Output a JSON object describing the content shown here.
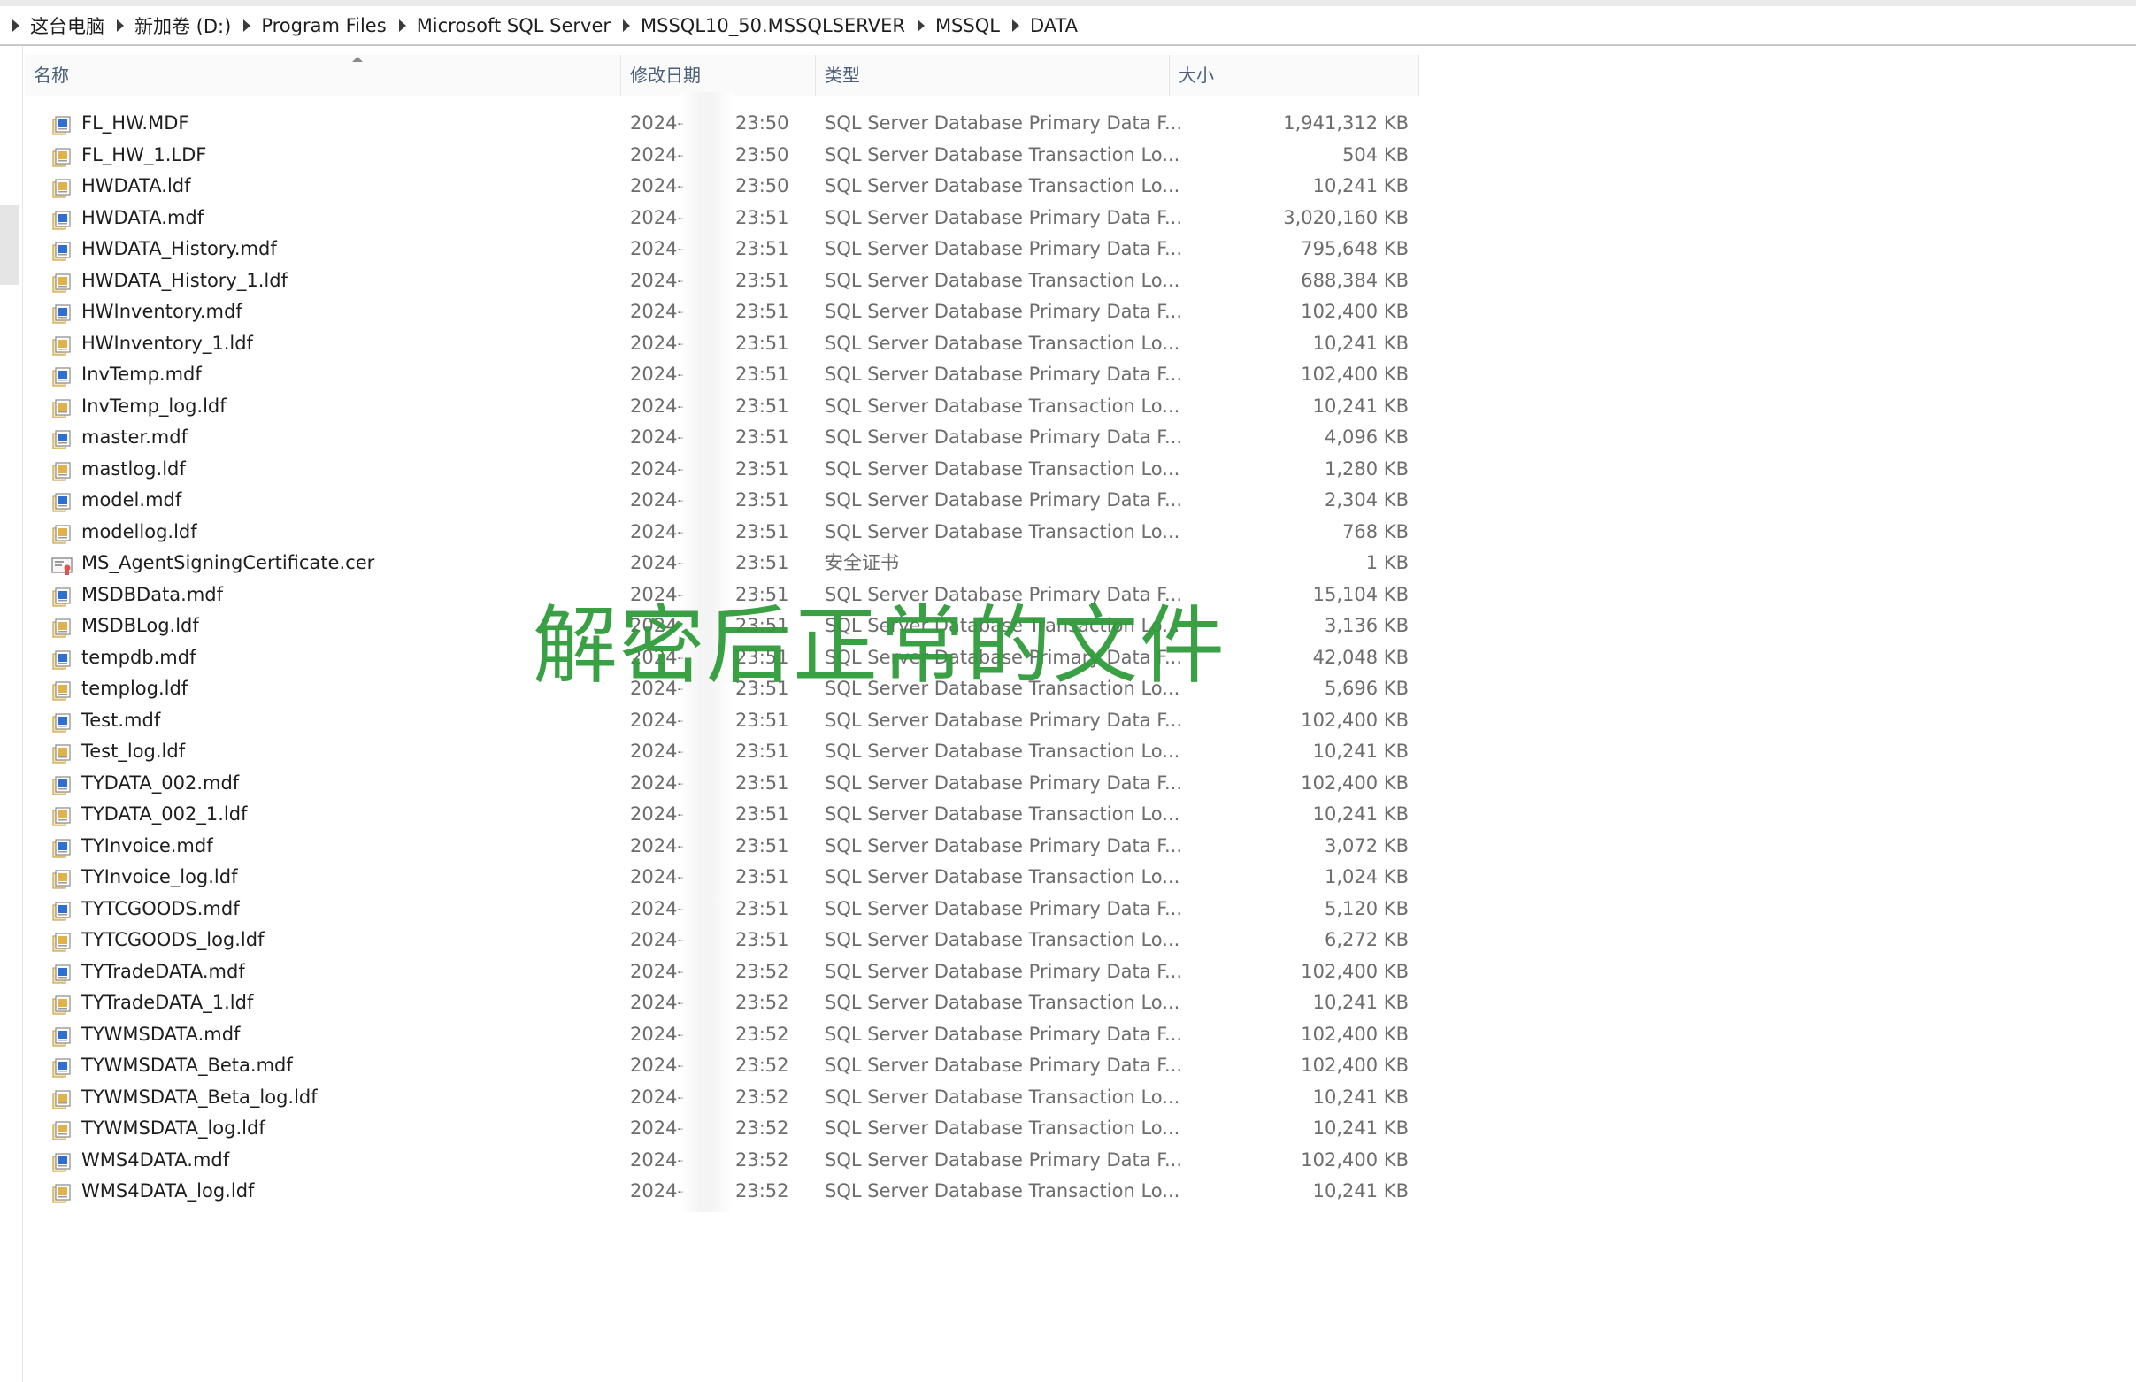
{
  "breadcrumb": [
    "这台电脑",
    "新加卷 (D:)",
    "Program Files",
    "Microsoft SQL Server",
    "MSSQL10_50.MSSQLSERVER",
    "MSSQL",
    "DATA"
  ],
  "columns": {
    "name": "名称",
    "date": "修改日期",
    "type": "类型",
    "size": "大小"
  },
  "watermark": "解密后正常的文件",
  "colors": {
    "watermark": "#2f9c3a",
    "header_text": "#4c607a",
    "mdf_icon": "#2f6fd1",
    "ldf_icon": "#e2b24a"
  },
  "files": [
    {
      "name": "FL_HW.MDF",
      "date": "2024-",
      "time": "23:50",
      "type": "SQL Server Database Primary Data F...",
      "size": "1,941,312 KB",
      "icon": "mdf-icon"
    },
    {
      "name": "FL_HW_1.LDF",
      "date": "2024-",
      "time": "23:50",
      "type": "SQL Server Database Transaction Lo...",
      "size": "504 KB",
      "icon": "ldf-icon"
    },
    {
      "name": "HWDATA.ldf",
      "date": "2024-",
      "time": "23:50",
      "type": "SQL Server Database Transaction Lo...",
      "size": "10,241 KB",
      "icon": "ldf-icon"
    },
    {
      "name": "HWDATA.mdf",
      "date": "2024-",
      "time": "23:51",
      "type": "SQL Server Database Primary Data F...",
      "size": "3,020,160 KB",
      "icon": "mdf-icon"
    },
    {
      "name": "HWDATA_History.mdf",
      "date": "2024-",
      "time": "23:51",
      "type": "SQL Server Database Primary Data F...",
      "size": "795,648 KB",
      "icon": "mdf-icon"
    },
    {
      "name": "HWDATA_History_1.ldf",
      "date": "2024-",
      "time": "23:51",
      "type": "SQL Server Database Transaction Lo...",
      "size": "688,384 KB",
      "icon": "ldf-icon"
    },
    {
      "name": "HWInventory.mdf",
      "date": "2024-",
      "time": "23:51",
      "type": "SQL Server Database Primary Data F...",
      "size": "102,400 KB",
      "icon": "mdf-icon"
    },
    {
      "name": "HWInventory_1.ldf",
      "date": "2024-",
      "time": "23:51",
      "type": "SQL Server Database Transaction Lo...",
      "size": "10,241 KB",
      "icon": "ldf-icon"
    },
    {
      "name": "InvTemp.mdf",
      "date": "2024-",
      "time": "23:51",
      "type": "SQL Server Database Primary Data F...",
      "size": "102,400 KB",
      "icon": "mdf-icon"
    },
    {
      "name": "InvTemp_log.ldf",
      "date": "2024-",
      "time": "23:51",
      "type": "SQL Server Database Transaction Lo...",
      "size": "10,241 KB",
      "icon": "ldf-icon"
    },
    {
      "name": "master.mdf",
      "date": "2024-",
      "time": "23:51",
      "type": "SQL Server Database Primary Data F...",
      "size": "4,096 KB",
      "icon": "mdf-icon"
    },
    {
      "name": "mastlog.ldf",
      "date": "2024-",
      "time": "23:51",
      "type": "SQL Server Database Transaction Lo...",
      "size": "1,280 KB",
      "icon": "ldf-icon"
    },
    {
      "name": "model.mdf",
      "date": "2024-",
      "time": "23:51",
      "type": "SQL Server Database Primary Data F...",
      "size": "2,304 KB",
      "icon": "mdf-icon"
    },
    {
      "name": "modellog.ldf",
      "date": "2024-",
      "time": "23:51",
      "type": "SQL Server Database Transaction Lo...",
      "size": "768 KB",
      "icon": "ldf-icon"
    },
    {
      "name": "MS_AgentSigningCertificate.cer",
      "date": "2024-",
      "time": "23:51",
      "type": "安全证书",
      "size": "1 KB",
      "icon": "certificate-icon"
    },
    {
      "name": "MSDBData.mdf",
      "date": "2024-",
      "time": "23:51",
      "type": "SQL Server Database Primary Data F...",
      "size": "15,104 KB",
      "icon": "mdf-icon"
    },
    {
      "name": "MSDBLog.ldf",
      "date": "2024-",
      "time": "23:51",
      "type": "SQL Server Database Transaction Lo...",
      "size": "3,136 KB",
      "icon": "ldf-icon"
    },
    {
      "name": "tempdb.mdf",
      "date": "2024-",
      "time": "23:51",
      "type": "SQL Server Database Primary Data F...",
      "size": "42,048 KB",
      "icon": "mdf-icon"
    },
    {
      "name": "templog.ldf",
      "date": "2024-",
      "time": "23:51",
      "type": "SQL Server Database Transaction Lo...",
      "size": "5,696 KB",
      "icon": "ldf-icon"
    },
    {
      "name": "Test.mdf",
      "date": "2024-",
      "time": "23:51",
      "type": "SQL Server Database Primary Data F...",
      "size": "102,400 KB",
      "icon": "mdf-icon"
    },
    {
      "name": "Test_log.ldf",
      "date": "2024-",
      "time": "23:51",
      "type": "SQL Server Database Transaction Lo...",
      "size": "10,241 KB",
      "icon": "ldf-icon"
    },
    {
      "name": "TYDATA_002.mdf",
      "date": "2024-",
      "time": "23:51",
      "type": "SQL Server Database Primary Data F...",
      "size": "102,400 KB",
      "icon": "mdf-icon"
    },
    {
      "name": "TYDATA_002_1.ldf",
      "date": "2024-",
      "time": "23:51",
      "type": "SQL Server Database Transaction Lo...",
      "size": "10,241 KB",
      "icon": "ldf-icon"
    },
    {
      "name": "TYInvoice.mdf",
      "date": "2024-",
      "time": "23:51",
      "type": "SQL Server Database Primary Data F...",
      "size": "3,072 KB",
      "icon": "mdf-icon"
    },
    {
      "name": "TYInvoice_log.ldf",
      "date": "2024-",
      "time": "23:51",
      "type": "SQL Server Database Transaction Lo...",
      "size": "1,024 KB",
      "icon": "ldf-icon"
    },
    {
      "name": "TYTCGOODS.mdf",
      "date": "2024-",
      "time": "23:51",
      "type": "SQL Server Database Primary Data F...",
      "size": "5,120 KB",
      "icon": "mdf-icon"
    },
    {
      "name": "TYTCGOODS_log.ldf",
      "date": "2024-",
      "time": "23:51",
      "type": "SQL Server Database Transaction Lo...",
      "size": "6,272 KB",
      "icon": "ldf-icon"
    },
    {
      "name": "TYTradeDATA.mdf",
      "date": "2024-",
      "time": "23:52",
      "type": "SQL Server Database Primary Data F...",
      "size": "102,400 KB",
      "icon": "mdf-icon"
    },
    {
      "name": "TYTradeDATA_1.ldf",
      "date": "2024-",
      "time": "23:52",
      "type": "SQL Server Database Transaction Lo...",
      "size": "10,241 KB",
      "icon": "ldf-icon"
    },
    {
      "name": "TYWMSDATA.mdf",
      "date": "2024-",
      "time": "23:52",
      "type": "SQL Server Database Primary Data F...",
      "size": "102,400 KB",
      "icon": "mdf-icon"
    },
    {
      "name": "TYWMSDATA_Beta.mdf",
      "date": "2024-",
      "time": "23:52",
      "type": "SQL Server Database Primary Data F...",
      "size": "102,400 KB",
      "icon": "mdf-icon"
    },
    {
      "name": "TYWMSDATA_Beta_log.ldf",
      "date": "2024-",
      "time": "23:52",
      "type": "SQL Server Database Transaction Lo...",
      "size": "10,241 KB",
      "icon": "ldf-icon"
    },
    {
      "name": "TYWMSDATA_log.ldf",
      "date": "2024-",
      "time": "23:52",
      "type": "SQL Server Database Transaction Lo...",
      "size": "10,241 KB",
      "icon": "ldf-icon"
    },
    {
      "name": "WMS4DATA.mdf",
      "date": "2024-",
      "time": "23:52",
      "type": "SQL Server Database Primary Data F...",
      "size": "102,400 KB",
      "icon": "mdf-icon"
    },
    {
      "name": "WMS4DATA_log.ldf",
      "date": "2024-",
      "time": "23:52",
      "type": "SQL Server Database Transaction Lo...",
      "size": "10,241 KB",
      "icon": "ldf-icon"
    }
  ]
}
